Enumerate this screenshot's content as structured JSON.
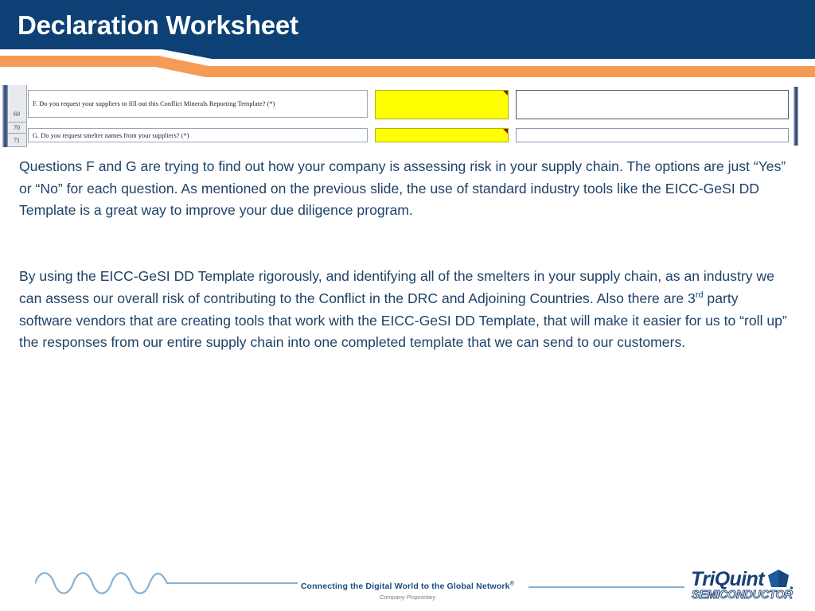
{
  "header": {
    "title": "Declaration Worksheet",
    "band_navy": "#0d4175",
    "band_orange": "#f59b55",
    "band_white": "#ffffff"
  },
  "spreadsheet": {
    "row_numbers": [
      "69",
      "70",
      "71"
    ],
    "questions": [
      {
        "id": "F",
        "text": "F. Do you request your suppliers to fill out this Conflict Minerals Reporting Template? (*)",
        "answer_value": "",
        "answer_fill": "#ffff00",
        "has_comment_flag": true,
        "note_value": ""
      },
      {
        "id": "G",
        "text": "G. Do you request smelter names from your suppliers? (*)",
        "answer_value": "",
        "answer_fill": "#ffff00",
        "has_comment_flag": true,
        "note_value": ""
      }
    ]
  },
  "body": {
    "paragraph_1_part_a": "Questions F and G are trying to find out how your company is assessing risk in your supply chain.  The options are just “Yes” or “No” for each question. As mentioned on the previous slide, the use of standard industry tools like the EICC-GeSI DD Template is a great way to improve your due diligence program.",
    "paragraph_2_part_a": "By using the EICC-GeSI DD Template rigorously, and identifying all of the smelters in your supply chain, as an industry we can assess our overall risk of contributing to the Conflict in the DRC and Adjoining Countries.  Also there are 3",
    "paragraph_2_sup": "rd",
    "paragraph_2_part_b": " party software vendors that are creating tools that work with the EICC-GeSI DD Template, that will make it easier for us to “roll up” the responses from our entire supply chain into one completed template that we can send to our customers.",
    "text_color": "#1e4268"
  },
  "footer": {
    "tagline": "Connecting the Digital World to the Global Network",
    "tagline_sup": "®",
    "subtitle": "Company Proprietary",
    "logo_word": "TriQuint",
    "logo_sub": "SEMICONDUCTOR",
    "accent_color": "#86b2d4",
    "logo_color": "#173f73"
  }
}
